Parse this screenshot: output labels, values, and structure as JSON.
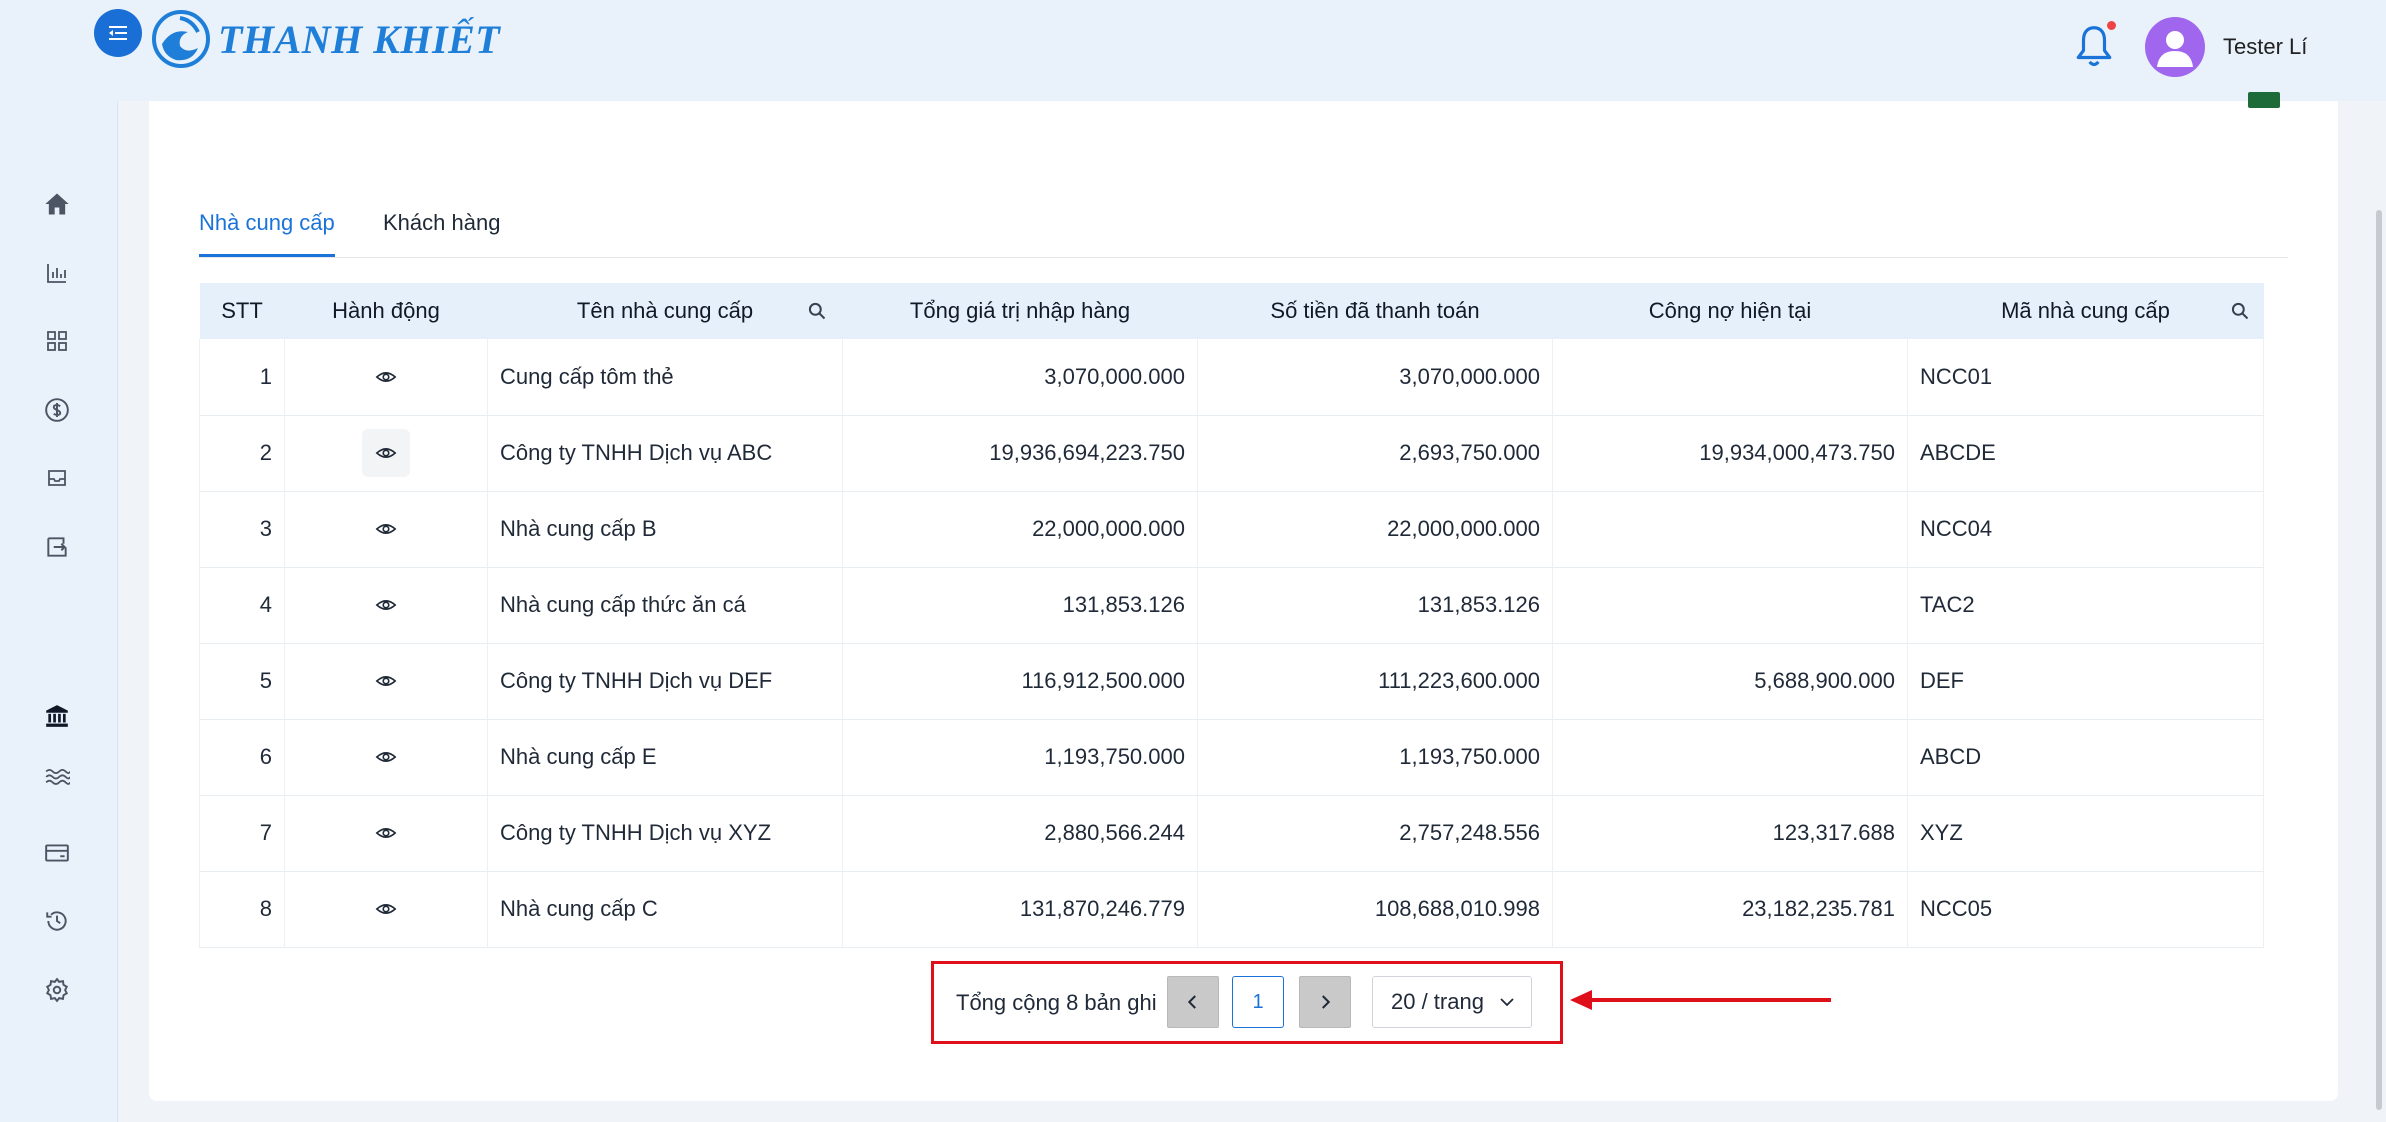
{
  "header": {
    "logo_text": "THANH KHIẾT",
    "user_name": "Tester Lí"
  },
  "sidebar": {
    "icons": [
      "home-icon",
      "bar-chart-icon",
      "grid-icon",
      "dollar-icon",
      "inbox-icon",
      "transfer-icon",
      "bank-icon",
      "waves-icon",
      "card-icon",
      "history-icon",
      "settings-icon"
    ]
  },
  "tabs": [
    {
      "label": "Nhà cung cấp",
      "active": true
    },
    {
      "label": "Khách hàng",
      "active": false
    }
  ],
  "table": {
    "headers": {
      "stt": "STT",
      "action": "Hành động",
      "name": "Tên nhà cung cấp",
      "total_import": "Tổng giá trị nhập hàng",
      "paid": "Số tiền đã thanh toán",
      "debt": "Công nợ hiện tại",
      "code": "Mã nhà cung cấp"
    },
    "rows": [
      {
        "stt": "1",
        "name": "Cung cấp tôm thẻ",
        "total_import": "3,070,000.000",
        "paid": "3,070,000.000",
        "debt": "",
        "code": "NCC01"
      },
      {
        "stt": "2",
        "name": "Công ty TNHH Dịch vụ ABC",
        "total_import": "19,936,694,223.750",
        "paid": "2,693,750.000",
        "debt": "19,934,000,473.750",
        "code": "ABCDE"
      },
      {
        "stt": "3",
        "name": "Nhà cung cấp B",
        "total_import": "22,000,000.000",
        "paid": "22,000,000.000",
        "debt": "",
        "code": "NCC04"
      },
      {
        "stt": "4",
        "name": "Nhà cung cấp thức ăn cá",
        "total_import": "131,853.126",
        "paid": "131,853.126",
        "debt": "",
        "code": "TAC2"
      },
      {
        "stt": "5",
        "name": "Công ty TNHH Dịch vụ DEF",
        "total_import": "116,912,500.000",
        "paid": "111,223,600.000",
        "debt": "5,688,900.000",
        "code": "DEF"
      },
      {
        "stt": "6",
        "name": "Nhà cung cấp E",
        "total_import": "1,193,750.000",
        "paid": "1,193,750.000",
        "debt": "",
        "code": "ABCD"
      },
      {
        "stt": "7",
        "name": "Công ty TNHH Dịch vụ XYZ",
        "total_import": "2,880,566.244",
        "paid": "2,757,248.556",
        "debt": "123,317.688",
        "code": "XYZ"
      },
      {
        "stt": "8",
        "name": "Nhà cung cấp C",
        "total_import": "131,870,246.779",
        "paid": "108,688,010.998",
        "debt": "23,182,235.781",
        "code": "NCC05"
      }
    ]
  },
  "pagination": {
    "total_label": "Tổng cộng 8 bản ghi",
    "current_page": "1",
    "page_size": "20 / trang"
  },
  "colors": {
    "accent": "#1a73d9",
    "highlight": "#e0101a",
    "header_bg": "#e6f0fa"
  }
}
